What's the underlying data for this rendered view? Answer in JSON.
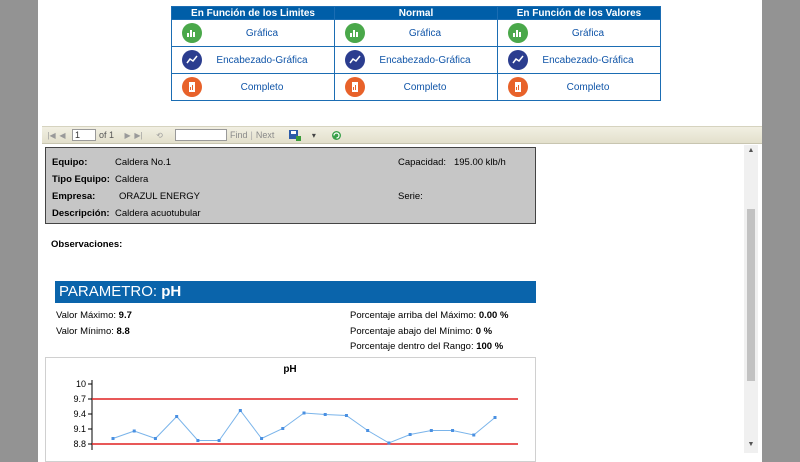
{
  "report_table": {
    "headers": [
      "En Función de los Limites",
      "Normal",
      "En Función de los Valores"
    ],
    "rows": [
      {
        "icon": "chart-magnifier-icon",
        "color": "#4aa84a",
        "labels": [
          "Gráfica",
          "Gráfica",
          "Gráfica"
        ]
      },
      {
        "icon": "line-chart-icon",
        "color": "#2b3d8f",
        "labels": [
          "Encabezado-Gráfica",
          "Encabezado-Gráfica",
          "Encabezado-Gráfica"
        ]
      },
      {
        "icon": "report-document-icon",
        "color": "#e8622a",
        "labels": [
          "Completo",
          "Completo",
          "Completo"
        ]
      }
    ]
  },
  "toolbar": {
    "page_value": "1",
    "of_text": "of 1",
    "find_label": "Find",
    "separator": "|",
    "next_label": "Next"
  },
  "equipment": {
    "equipo_label": "Equipo:",
    "equipo_value": "Caldera No.1",
    "tipo_label": "Tipo Equipo:",
    "tipo_value": "Caldera",
    "empresa_label": "Empresa:",
    "empresa_value": "ORAZUL ENERGY",
    "descripcion_label": "Descripción:",
    "descripcion_value": "Caldera acuotubular",
    "capacidad_label": "Capacidad:",
    "capacidad_value": "195.00 klb/h",
    "serie_label": "Serie:",
    "serie_value": ""
  },
  "observaciones_label": "Observaciones:",
  "parameter": {
    "prefix": "PARAMETRO: ",
    "name": "pH",
    "max_label": "Valor Máximo: ",
    "max_value": "9.7",
    "min_label": "Valor Mínimo: ",
    "min_value": "8.8",
    "above_label": "Porcentaje arriba del Máximo: ",
    "above_value": "0.00 %",
    "below_label": "Porcentaje abajo del Mínimo: ",
    "below_value": "0 %",
    "within_label": "Porcentaje dentro del Rango: ",
    "within_value": "100 %"
  },
  "chart_data": {
    "type": "line",
    "title": "pH",
    "xlabel": "",
    "ylabel": "",
    "ylim": [
      8.8,
      10
    ],
    "yticks": [
      "10",
      "9.7",
      "9.4",
      "9.1",
      "8.8"
    ],
    "grid": false,
    "series": [
      {
        "values": [
          8.91,
          9.06,
          8.91,
          9.35,
          8.87,
          8.87,
          9.47,
          8.91,
          9.11,
          9.42,
          9.39,
          9.37,
          9.07,
          8.82,
          8.99,
          9.07,
          9.07,
          8.98,
          9.33
        ],
        "color": "#4a90e2"
      }
    ],
    "reference_lines": [
      {
        "value": 9.7,
        "color": "#e02020"
      },
      {
        "value": 8.8,
        "color": "#e02020"
      }
    ]
  }
}
